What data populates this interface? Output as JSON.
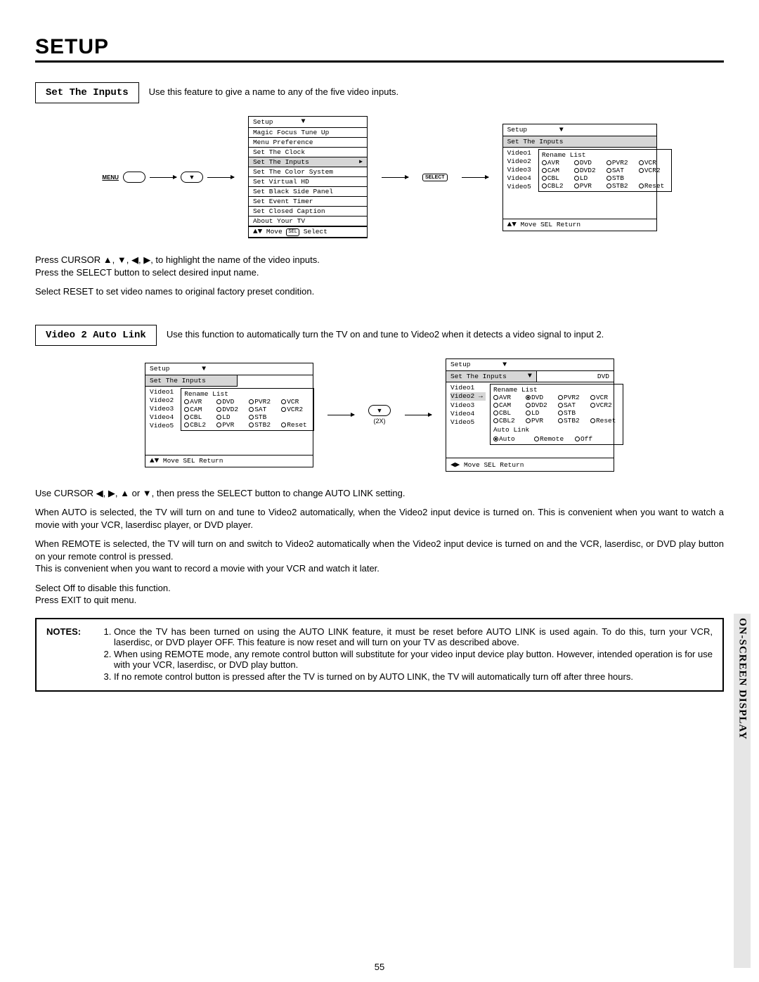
{
  "page": {
    "title": "SETUP",
    "number": "55",
    "side_tab": "ON-SCREEN DISPLAY"
  },
  "section1": {
    "box": "Set The Inputs",
    "desc": "Use this feature to give a name to any of the five video inputs.",
    "menu_label": "MENU",
    "select_label": "SELECT",
    "osd_menu": {
      "title": "Setup",
      "items": [
        "Magic Focus Tune Up",
        "Menu Preference",
        "Set The Clock",
        "Set The Inputs",
        "Set The Color System",
        "Set Virtual HD",
        "Set Black Side Panel",
        "Set Event Timer",
        "Set Closed Caption",
        "About Your TV"
      ],
      "highlight": "Set The Inputs",
      "foot_move": "Move",
      "foot_sel": "SEL",
      "foot_select": "Select"
    },
    "osd_inputs": {
      "title": "Setup",
      "sub": "Set The Inputs",
      "video1": "Video1",
      "rename": "Rename List",
      "rows": [
        {
          "v": "Video2",
          "opts": [
            "AVR",
            "DVD",
            "PVR2",
            "VCR"
          ]
        },
        {
          "v": "Video3",
          "opts": [
            "CAM",
            "DVD2",
            "SAT",
            "VCR2"
          ]
        },
        {
          "v": "Video4",
          "opts": [
            "CBL",
            "LD",
            "STB",
            ""
          ]
        },
        {
          "v": "Video5",
          "opts": [
            "CBL2",
            "PVR",
            "STB2",
            "Reset"
          ]
        }
      ],
      "foot_move": "Move",
      "foot_sel": "SEL",
      "foot_return": "Return"
    },
    "p1": "Press CURSOR ▲, ▼, ◀, ▶, to highlight the name of the video inputs.",
    "p2": "Press the SELECT button to select desired input name.",
    "p3": "Select RESET to set video names to original factory preset condition."
  },
  "section2": {
    "box": "Video 2 Auto Link",
    "desc": "Use this function to automatically turn the TV on and tune to Video2 when it detects a video signal to input 2.",
    "arrow_count": "(2X)",
    "osd_left": {
      "title": "Setup",
      "sub": "Set The Inputs",
      "video1": "Video1",
      "rename": "Rename List",
      "rows": [
        {
          "v": "Video2",
          "opts": [
            "AVR",
            "DVD",
            "PVR2",
            "VCR"
          ]
        },
        {
          "v": "Video3",
          "opts": [
            "CAM",
            "DVD2",
            "SAT",
            "VCR2"
          ]
        },
        {
          "v": "Video4",
          "opts": [
            "CBL",
            "LD",
            "STB",
            ""
          ]
        },
        {
          "v": "Video5",
          "opts": [
            "CBL2",
            "PVR",
            "STB2",
            "Reset"
          ]
        }
      ],
      "foot_move": "Move",
      "foot_sel": "SEL",
      "foot_return": "Return"
    },
    "osd_right": {
      "title": "Setup",
      "sub": "Set The Inputs",
      "dvd": "DVD",
      "video1": "Video1",
      "rename": "Rename List",
      "rows": [
        {
          "v": "Video2",
          "hl": true,
          "opts": [
            "AVR",
            "DVD",
            "PVR2",
            "VCR"
          ],
          "sel": "DVD"
        },
        {
          "v": "Video3",
          "opts": [
            "CAM",
            "DVD2",
            "SAT",
            "VCR2"
          ]
        },
        {
          "v": "Video4",
          "opts": [
            "CBL",
            "LD",
            "STB",
            ""
          ]
        },
        {
          "v": "Video5",
          "opts": [
            "CBL2",
            "PVR",
            "STB2",
            "Reset"
          ]
        }
      ],
      "autolink_label": "Auto Link",
      "autolink_opts": [
        "Auto",
        "Remote",
        "Off"
      ],
      "autolink_sel": "Auto",
      "foot_move": "Move",
      "foot_sel": "SEL",
      "foot_return": "Return"
    },
    "p1": "Use CURSOR ◀, ▶, ▲ or ▼, then press the SELECT button to change AUTO LINK setting.",
    "p2": "When AUTO is selected, the TV will turn on and tune to Video2 automatically, when the Video2 input device is turned on. This is convenient when you want to watch a movie with your VCR, laserdisc player, or DVD player.",
    "p3": "When REMOTE is selected, the TV will turn on and switch to Video2 automatically when the Video2 input device is turned on and the VCR, laserdisc, or DVD play button on your remote control is pressed.",
    "p4": "This is convenient when you want to record a movie with your VCR and watch it later.",
    "p5": "Select Off to disable this function.",
    "p6": "Press EXIT to quit menu."
  },
  "notes": {
    "label": "NOTES:",
    "items": [
      "Once the TV has been turned on using the AUTO LINK feature, it must be reset before AUTO LINK is used again. To do this, turn your VCR, laserdisc, or DVD player OFF. This feature is now reset and will turn on your TV as described above.",
      "When using REMOTE mode, any remote control button will substitute for your video input device play button. However, intended operation is for use with your VCR, laserdisc, or DVD play button.",
      "If no remote control button is pressed after the TV is turned on by AUTO LINK, the TV will automatically turn off after three hours."
    ]
  }
}
